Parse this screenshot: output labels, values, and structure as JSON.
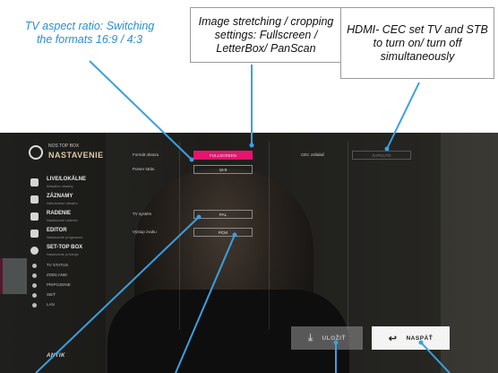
{
  "callouts": {
    "aspect": "TV aspect ratio: Switching the formats 16:9 / 4:3",
    "stretch": "Image stretching / cropping settings: Fullscreen / LetterBox/ PanScan",
    "hdmi": "HDMI- CEC set TV and STB to turn on/ turn off simultaneously"
  },
  "app": {
    "logo_line1": "NOS TOP BOX",
    "logo_line2": "NASTAVENIE",
    "brand": "ANTIK"
  },
  "sidebar": {
    "items": [
      {
        "label": "LIVE/LOKÁLNE",
        "sub": "Aktuálne obsahy"
      },
      {
        "label": "ZÁZNAMY",
        "sub": "Nahrávanie obsahu"
      },
      {
        "label": "RADENIE",
        "sub": "Nastavenie radenia"
      },
      {
        "label": "EDITOR",
        "sub": "Nastavenie programov"
      },
      {
        "label": "SET-TOP BOX",
        "sub": "Nastavenie prístroja"
      }
    ],
    "small_items": [
      "TV STATUS",
      "ZDIEĽANIE",
      "PRIPOJENIE",
      "SIEŤ",
      "LAN",
      "WIFI"
    ]
  },
  "panel": {
    "format_label": "Formát obrazu",
    "format_value": "FULLSCREEN",
    "ratio_label": "Pomer strán",
    "ratio_value": "16:9",
    "cec_label": "CEC ovládač",
    "cec_value": "ZAPNUTÉ",
    "tv_standard_label": "TV systém",
    "tv_standard_value": "PAL",
    "output_label": "Výstup zvuku",
    "output_value": "PCM"
  },
  "buttons": {
    "save": "ULOŽIŤ",
    "back": "NASPÄŤ"
  },
  "colors": {
    "accent": "#e5146f",
    "callout_blue": "#2a8fd0",
    "leader_blue": "#3aa0e0"
  }
}
